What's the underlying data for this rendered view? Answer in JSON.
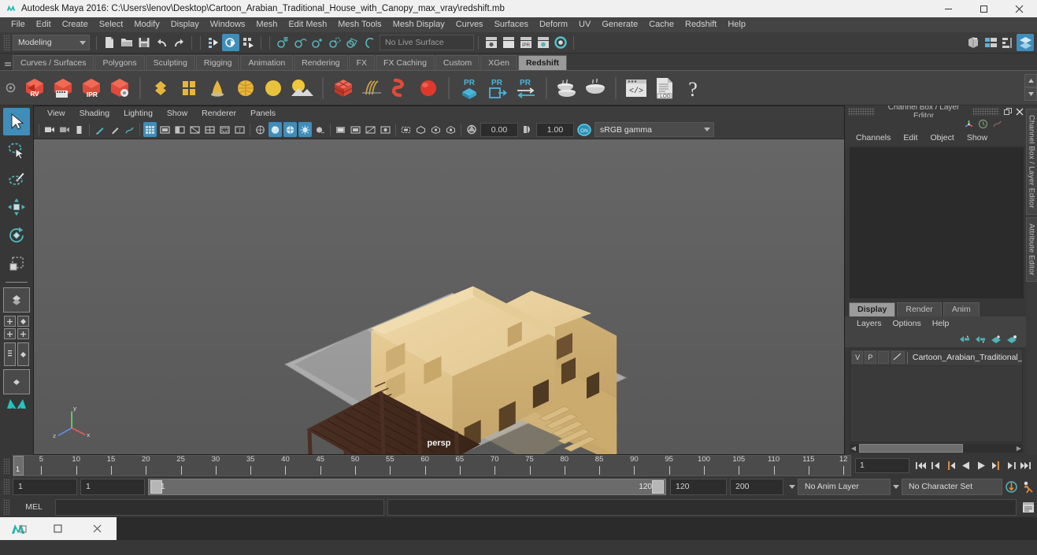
{
  "window": {
    "title": "Autodesk Maya 2016: C:\\Users\\lenov\\Desktop\\Cartoon_Arabian_Traditional_House_with_Canopy_max_vray\\redshift.mb",
    "app_icon": "maya-logo-icon",
    "minimize": "minimize-icon",
    "maximize": "maximize-icon",
    "close": "close-icon"
  },
  "menubar": {
    "items": [
      "File",
      "Edit",
      "Create",
      "Select",
      "Modify",
      "Display",
      "Windows",
      "Mesh",
      "Edit Mesh",
      "Mesh Tools",
      "Mesh Display",
      "Curves",
      "Surfaces",
      "Deform",
      "UV",
      "Generate",
      "Cache",
      "Redshift",
      "Help"
    ]
  },
  "statusline": {
    "menu_set": "Modeling",
    "live_surface": "No Live Surface",
    "icons": [
      "new-scene-icon",
      "open-scene-icon",
      "save-scene-icon",
      "undo-icon",
      "redo-icon",
      "select-by-hierarchy-icon",
      "select-by-object-icon",
      "select-by-component-icon",
      "snap-to-grid-icon",
      "snap-to-curve-icon",
      "snap-to-point-icon",
      "snap-to-projected-center-icon",
      "snap-to-view-plane-icon",
      "make-live-icon",
      "render-view-icon",
      "render-current-frame-icon",
      "ipr-render-icon",
      "render-settings-icon",
      "hypershade-icon",
      "show-outliner-icon",
      "show-attribute-editor-icon",
      "show-tool-settings-icon",
      "show-channel-box-icon"
    ]
  },
  "shelf": {
    "tabs": [
      "Curves / Surfaces",
      "Polygons",
      "Sculpting",
      "Rigging",
      "Animation",
      "Rendering",
      "FX",
      "FX Caching",
      "Custom",
      "XGen",
      "Redshift"
    ],
    "active_tab": "Redshift",
    "buttons": [
      {
        "name": "redshift-render-view",
        "label": "RV",
        "kind": "hex"
      },
      {
        "name": "redshift-render-sequence",
        "label": "FILM",
        "kind": "hex"
      },
      {
        "name": "redshift-ipr",
        "label": "IPR",
        "kind": "hex"
      },
      {
        "name": "redshift-render-settings",
        "label": "GEAR",
        "kind": "hex"
      },
      {
        "name": "redshift-lights-dome",
        "kind": "diamond"
      },
      {
        "name": "redshift-area-light",
        "kind": "panel"
      },
      {
        "name": "redshift-ies-light",
        "kind": "cone"
      },
      {
        "name": "redshift-dome-light",
        "kind": "dome"
      },
      {
        "name": "redshift-portal-light",
        "kind": "disc"
      },
      {
        "name": "redshift-physical-sun",
        "kind": "sun"
      },
      {
        "name": "redshift-proxy-cube",
        "kind": "proxycube"
      },
      {
        "name": "redshift-hair",
        "kind": "hair"
      },
      {
        "name": "redshift-curve",
        "kind": "curve"
      },
      {
        "name": "redshift-sphere",
        "kind": "sphere"
      },
      {
        "name": "redshift-proxy-export",
        "label": "PR",
        "kind": "pr-cube"
      },
      {
        "name": "redshift-proxy-import",
        "label": "PR",
        "kind": "pr-export"
      },
      {
        "name": "redshift-proxy-replace",
        "label": "PR",
        "kind": "pr-swap"
      },
      {
        "name": "redshift-bake-set",
        "kind": "bake1"
      },
      {
        "name": "redshift-bake-render",
        "kind": "bake2"
      },
      {
        "name": "redshift-script-editor",
        "kind": "script"
      },
      {
        "name": "redshift-log",
        "label": "LOG",
        "kind": "log"
      },
      {
        "name": "redshift-help",
        "label": "?",
        "kind": "help"
      }
    ]
  },
  "toolbox": {
    "tools": [
      {
        "name": "select-tool",
        "active": true
      },
      {
        "name": "lasso-select-tool",
        "active": false
      },
      {
        "name": "paint-select-tool",
        "active": false
      },
      {
        "name": "move-tool",
        "active": false
      },
      {
        "name": "rotate-tool",
        "active": false
      },
      {
        "name": "scale-tool",
        "active": false
      }
    ],
    "layout_presets": [
      "single-perspective-view",
      "four-view-layout",
      "outliner-persp-layout",
      "persp-graph-layout"
    ]
  },
  "viewport": {
    "menus": [
      "View",
      "Shading",
      "Lighting",
      "Show",
      "Renderer",
      "Panels"
    ],
    "camera_label": "persp",
    "exposure": "0.00",
    "gamma": "1.00",
    "view_transform": "sRGB gamma",
    "color_mgmt_toggle": "ON",
    "axis_labels": {
      "x": "x",
      "y": "y",
      "z": "z"
    },
    "toolbar_icons": [
      "select-camera-icon",
      "lock-camera-icon",
      "camera-attributes-icon",
      "bookmark-icon",
      "image-plane-icon",
      "two-d-pan-zoom-icon",
      "grid-icon",
      "film-gate-icon",
      "resolution-gate-icon",
      "gate-mask-icon",
      "field-chart-icon",
      "safe-action-icon",
      "safe-title-icon",
      "wireframe-icon",
      "smooth-shade-icon",
      "hardware-texturing-icon",
      "use-all-lights-icon",
      "shadows-icon",
      "ambient-occlusion-icon",
      "motion-blur-icon",
      "multisample-icon",
      "depth-of-field-icon",
      "isolate-select-icon",
      "xray-icon",
      "xray-joints-icon",
      "xray-active-components-icon",
      "exposure-icon",
      "gamma-icon",
      "color-management-icon"
    ]
  },
  "channelbox": {
    "panel_title": "Channel Box / Layer Editor",
    "undock_icon": "undock-icon",
    "close_icon": "close-panel-icon",
    "menus": [
      "Channels",
      "Edit",
      "Object",
      "Show"
    ]
  },
  "layereditor": {
    "tabs": [
      "Display",
      "Render",
      "Anim"
    ],
    "active_tab": "Display",
    "menus": [
      "Layers",
      "Options",
      "Help"
    ],
    "tool_icons": [
      "move-layer-up-icon",
      "move-layer-down-icon",
      "new-layer-icon",
      "new-layer-from-selected-icon"
    ],
    "layers": [
      {
        "visibility": "V",
        "playback": "P",
        "shading": "",
        "name": "Cartoon_Arabian_Traditional_H"
      }
    ]
  },
  "sidetabs": [
    "Channel Box / Layer Editor",
    "Attribute Editor"
  ],
  "timeline": {
    "start": 1,
    "end": 120,
    "current_frame": "1",
    "tick_labels": [
      "5",
      "10",
      "15",
      "20",
      "25",
      "30",
      "35",
      "40",
      "45",
      "50",
      "55",
      "60",
      "65",
      "70",
      "75",
      "80",
      "85",
      "90",
      "95",
      "100",
      "105",
      "110",
      "115",
      "12"
    ],
    "playback_buttons": [
      "go-to-start-icon",
      "step-back-keyframe-icon",
      "step-back-frame-icon",
      "play-backwards-icon",
      "play-forwards-icon",
      "step-forward-frame-icon",
      "step-forward-keyframe-icon",
      "go-to-end-icon"
    ]
  },
  "rangeslider": {
    "anim_start": "1",
    "range_start": "1",
    "bar_start_label": "1",
    "bar_end_label": "120",
    "range_end": "120",
    "anim_end": "200",
    "anim_layer": "No Anim Layer",
    "character_set": "No Character Set",
    "auto_key_icon": "auto-keyframe-icon",
    "anim_prefs_icon": "animation-preferences-icon"
  },
  "commandline": {
    "language": "MEL",
    "input_value": "",
    "output_value": "",
    "script_editor_icon": "script-editor-icon"
  },
  "taskbar": {
    "buttons": [
      "maya-app-icon",
      "restore-window-icon",
      "close-window-icon"
    ]
  },
  "colors": {
    "accent": "#3f8dbb",
    "panel": "#373737",
    "shelf_active": "#9a9a9a",
    "redshift_red": "#d8463c",
    "redshift_yellow": "#e8b53c",
    "viewport_bg": "#5e5e5e",
    "house_wall": "#e8cd96",
    "canopy_brown": "#5a3a2a"
  }
}
